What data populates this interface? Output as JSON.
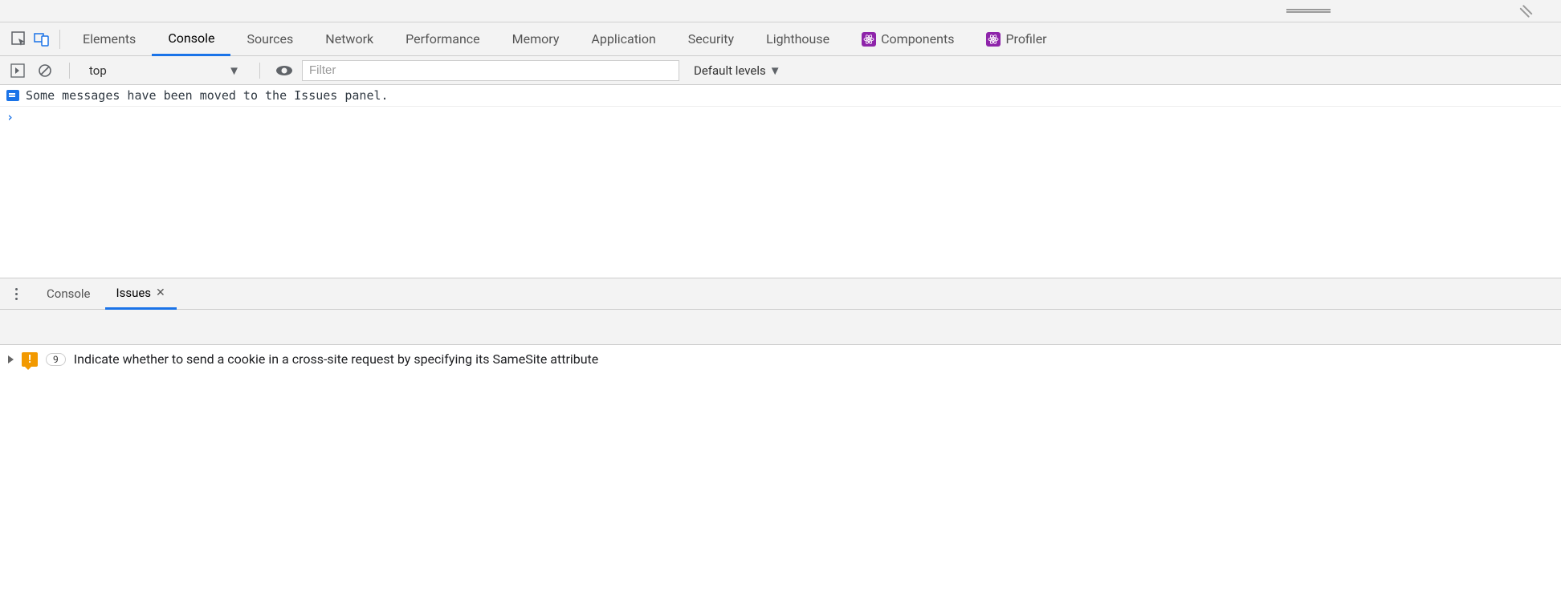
{
  "main_tabs": {
    "elements": "Elements",
    "console": "Console",
    "sources": "Sources",
    "network": "Network",
    "performance": "Performance",
    "memory": "Memory",
    "application": "Application",
    "security": "Security",
    "lighthouse": "Lighthouse",
    "components": "Components",
    "profiler": "Profiler"
  },
  "sub_toolbar": {
    "context": "top",
    "filter_placeholder": "Filter",
    "levels": "Default levels"
  },
  "console": {
    "info_message": "Some messages have been moved to the Issues panel."
  },
  "drawer_tabs": {
    "console": "Console",
    "issues": "Issues"
  },
  "issues": {
    "count": "9",
    "message": "Indicate whether to send a cookie in a cross-site request by specifying its SameSite attribute"
  }
}
